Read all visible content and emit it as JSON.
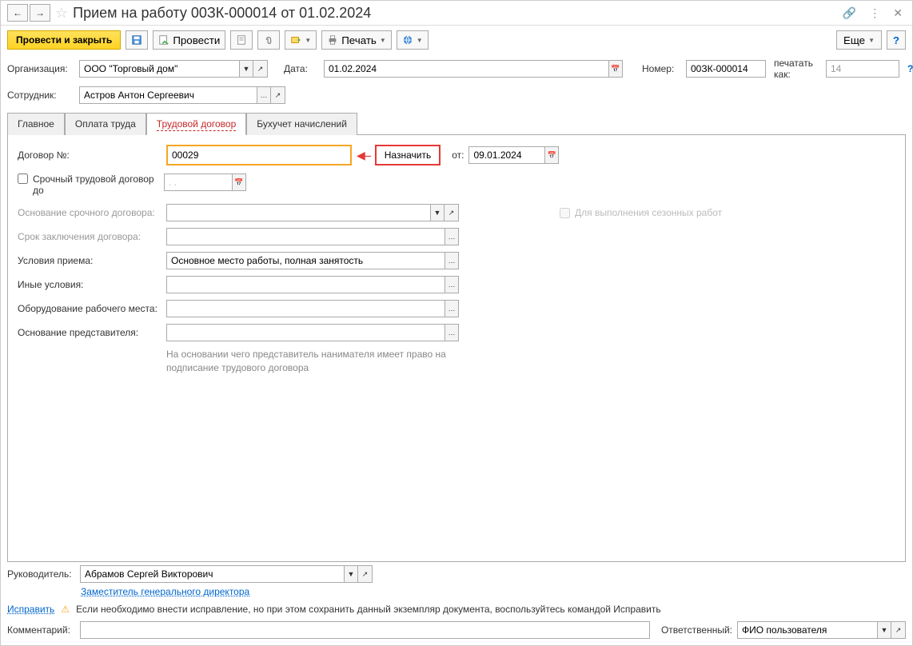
{
  "header": {
    "title": "Прием на работу 00ЗК-000014 от 01.02.2024"
  },
  "toolbar": {
    "post_close": "Провести и закрыть",
    "post": "Провести",
    "print": "Печать",
    "more": "Еще",
    "help": "?"
  },
  "fields": {
    "org_label": "Организация:",
    "org_value": "ООО \"Торговый дом\"",
    "date_label": "Дата:",
    "date_value": "01.02.2024",
    "number_label": "Номер:",
    "number_value": "00ЗК-000014",
    "print_as_label": "печатать как:",
    "print_as_value": "14",
    "employee_label": "Сотрудник:",
    "employee_value": "Астров Антон Сергеевич"
  },
  "tabs": {
    "main": "Главное",
    "payment": "Оплата труда",
    "contract": "Трудовой договор",
    "accounting": "Бухучет начислений"
  },
  "contract": {
    "number_label": "Договор №:",
    "number_value": "00029",
    "assign": "Назначить",
    "from_label": "от:",
    "from_date": "09.01.2024",
    "fixed_term_label": "Срочный трудовой договор до",
    "fixed_term_date": ". .",
    "basis_label": "Основание срочного договора:",
    "term_label": "Срок заключения договора:",
    "conditions_label": "Условия приема:",
    "conditions_value": "Основное место работы, полная занятость",
    "other_label": "Иные условия:",
    "equipment_label": "Оборудование рабочего места:",
    "rep_basis_label": "Основание представителя:",
    "rep_hint": "На основании чего представитель нанимателя имеет право на подписание трудового договора",
    "seasonal_label": "Для выполнения сезонных работ"
  },
  "footer": {
    "manager_label": "Руководитель:",
    "manager_value": "Абрамов Сергей Викторович",
    "manager_position": "Заместитель генерального директора",
    "fix_link": "Исправить",
    "warn_text": "Если необходимо внести исправление, но при этом сохранить данный экземпляр документа, воспользуйтесь командой Исправить",
    "comment_label": "Комментарий:",
    "responsible_label": "Ответственный:",
    "responsible_value": "ФИО пользователя"
  }
}
